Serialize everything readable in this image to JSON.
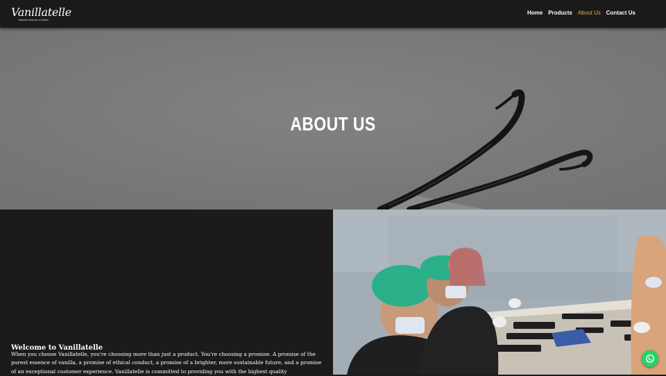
{
  "brand": {
    "name": "Vanillatelle",
    "tagline": "Taste the Essence of Vanilla"
  },
  "nav": {
    "items": [
      {
        "label": "Home",
        "active": false
      },
      {
        "label": "Products",
        "active": false
      },
      {
        "label": "About Us",
        "active": true
      },
      {
        "label": "Contact Us",
        "active": false
      }
    ]
  },
  "hero": {
    "title": "ABOUT US"
  },
  "about": {
    "heading": "Welcome to Vanillatelle",
    "paragraph": "When you choose Vanillatelle, you're choosing more than just a product. You're choosing a promise. A promise of the purest essence of vanilla, a promise of ethical conduct, a promise of a brighter, more sustainable future, and a promise of an exceptional customer experience. Vanillatelle is committed to providing you with the highest quality"
  },
  "colors": {
    "nav_bg": "#1a1a1a",
    "accent": "#e0a95f",
    "hero_bg": "#7c7c7c",
    "page_bg": "#1b1b1b",
    "whatsapp": "#25d366"
  },
  "icons": {
    "floating_button": "whatsapp-icon"
  }
}
